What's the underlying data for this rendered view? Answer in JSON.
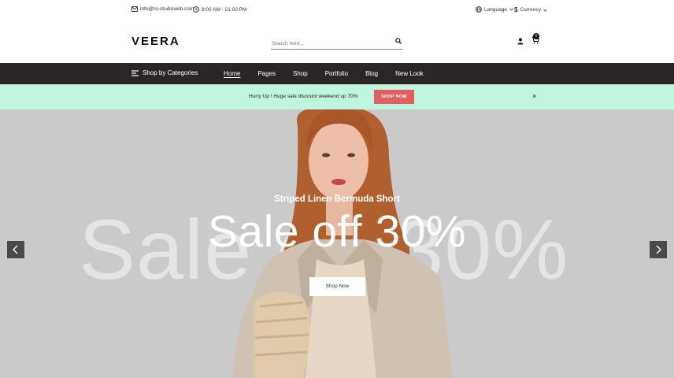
{
  "topbar": {
    "email": "info@ro-studioweb.com",
    "hours": "9:00 AM - 21:00 PM",
    "language_label": "Language",
    "currency_label": "Currency",
    "currency_symbol": "$"
  },
  "header": {
    "logo": "VEERA",
    "search_placeholder": "Search here...",
    "cart_count": "0"
  },
  "nav": {
    "categories_label": "Shop by Categories",
    "links": [
      {
        "label": "Home",
        "active": true
      },
      {
        "label": "Pages"
      },
      {
        "label": "Shop"
      },
      {
        "label": "Portfolio"
      },
      {
        "label": "Blog"
      },
      {
        "label": "New Look"
      }
    ]
  },
  "promo": {
    "text": "Hurry Up ! Huge sale discount weekend up 70%",
    "button_label": "SHOP NOW",
    "close_glyph": "×"
  },
  "hero": {
    "subtitle": "Striped Linen Bermuda Short",
    "headline": "Sale off 30%",
    "background_word": "Sale off 30%",
    "button_label": "Shop Now"
  },
  "colors": {
    "nav_bg": "#2a2627",
    "promo_bg": "#c0f5e0",
    "promo_button": "#e06060",
    "hero_bg": "#cbcacb",
    "arrow_bg": "#4a4a4a"
  },
  "icons": [
    "mail-icon",
    "clock-icon",
    "globe-icon",
    "dollar-icon",
    "chevron-down-icon",
    "search-icon",
    "user-icon",
    "cart-icon",
    "menu-icon",
    "close-icon",
    "chevron-left-icon",
    "chevron-right-icon"
  ]
}
